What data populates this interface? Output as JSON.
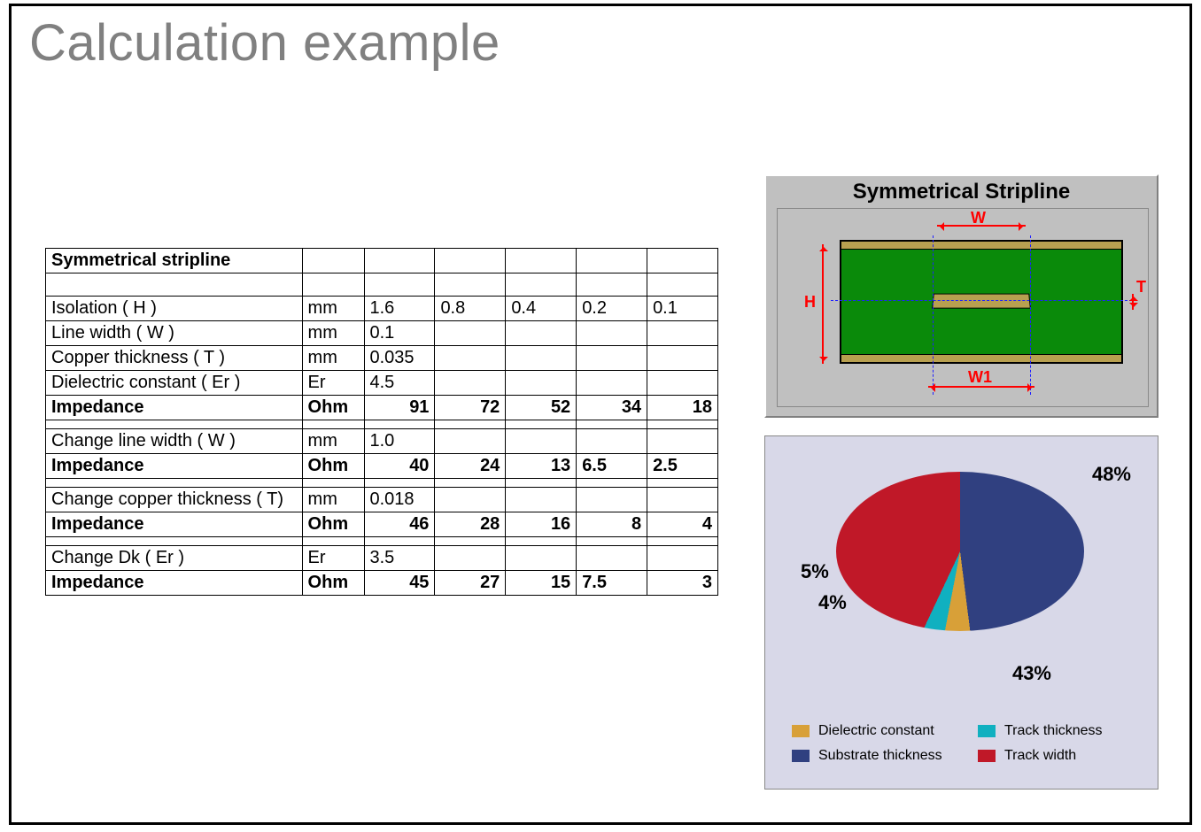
{
  "title": "Calculation example",
  "table": {
    "header": "Symmetrical stripline",
    "rows": {
      "isolation": {
        "label": "Isolation ( H )",
        "unit": "mm",
        "v": [
          "1.6",
          "0.8",
          "0.4",
          "0.2",
          "0.1"
        ]
      },
      "linewidth": {
        "label": "Line width ( W )",
        "unit": "mm",
        "v": [
          "0.1",
          "",
          "",
          "",
          ""
        ]
      },
      "copper": {
        "label": "Copper thickness ( T )",
        "unit": "mm",
        "v": [
          "0.035",
          "",
          "",
          "",
          ""
        ]
      },
      "er": {
        "label": "Dielectric constant ( Er )",
        "unit": "Er",
        "v": [
          "4.5",
          "",
          "",
          "",
          ""
        ]
      },
      "imp1": {
        "label": "Impedance",
        "unit": "Ohm",
        "v": [
          "91",
          "72",
          "52",
          "34",
          "18"
        ]
      },
      "chg_w": {
        "label": "Change  line width ( W )",
        "unit": "mm",
        "v": [
          "1.0",
          "",
          "",
          "",
          ""
        ]
      },
      "imp2": {
        "label": "Impedance",
        "unit": "Ohm",
        "v": [
          "40",
          "24",
          "13",
          "6.5",
          "2.5"
        ]
      },
      "chg_t": {
        "label": "Change copper thickness ( T)",
        "unit": "mm",
        "v": [
          "0.018",
          "",
          "",
          "",
          ""
        ]
      },
      "imp3": {
        "label": "Impedance",
        "unit": "Ohm",
        "v": [
          "46",
          "28",
          "16",
          "8",
          "4"
        ]
      },
      "chg_er": {
        "label": "Change Dk ( Er )",
        "unit": "Er",
        "v": [
          "3.5",
          "",
          "",
          "",
          ""
        ]
      },
      "imp4": {
        "label": "Impedance",
        "unit": "Ohm",
        "v": [
          "45",
          "27",
          "15",
          "7.5",
          "3"
        ]
      }
    }
  },
  "diagram": {
    "title": "Symmetrical Stripline",
    "labels": {
      "H": "H",
      "W": "W",
      "W1": "W1",
      "T": "T"
    }
  },
  "chart_data": {
    "type": "pie",
    "title": "",
    "series": [
      {
        "name": "Substrate thickness",
        "value": 48,
        "color": "#304080"
      },
      {
        "name": "Track width",
        "value": 43,
        "color": "#c01828"
      },
      {
        "name": "Dielectric constant",
        "value": 5,
        "color": "#d8a038"
      },
      {
        "name": "Track thickness",
        "value": 4,
        "color": "#10b0c0"
      }
    ],
    "labels": {
      "p48": "48%",
      "p43": "43%",
      "p5": "5%",
      "p4": "4%"
    }
  },
  "legend": {
    "dielectric": "Dielectric constant",
    "track_thickness": "Track thickness",
    "substrate": "Substrate thickness",
    "track_width": "Track width"
  }
}
